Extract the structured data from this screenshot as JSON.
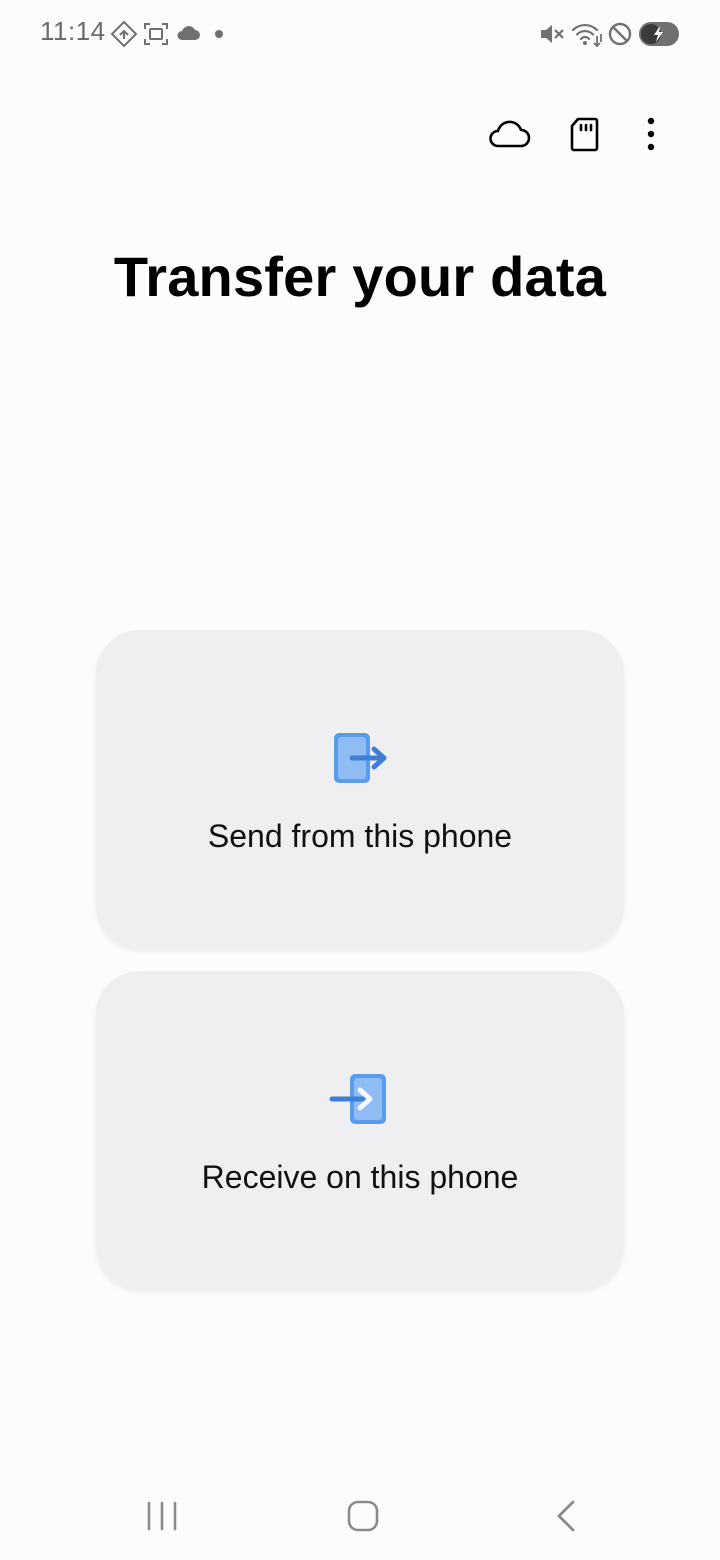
{
  "status_bar": {
    "time": "11:14",
    "left_icons": [
      "navigation-diamond-icon",
      "screenshot-icon",
      "cloud-icon",
      "dot-icon"
    ],
    "right_icons": [
      "mute-icon",
      "wifi-icon",
      "do-not-disturb-icon",
      "battery-charging-icon"
    ]
  },
  "app_bar": {
    "actions": [
      "cloud-icon",
      "sd-card-icon",
      "more-options-icon"
    ]
  },
  "main": {
    "title": "Transfer your data",
    "options": [
      {
        "label": "Send from this phone",
        "icon": "send-phone-icon"
      },
      {
        "label": "Receive on this phone",
        "icon": "receive-phone-icon"
      }
    ]
  },
  "nav_bar": {
    "buttons": [
      "recents-button",
      "home-button",
      "back-button"
    ]
  },
  "colors": {
    "accent_blue": "#5a9cec",
    "card_background": "#efeff1",
    "page_background": "#fcfcfc"
  }
}
